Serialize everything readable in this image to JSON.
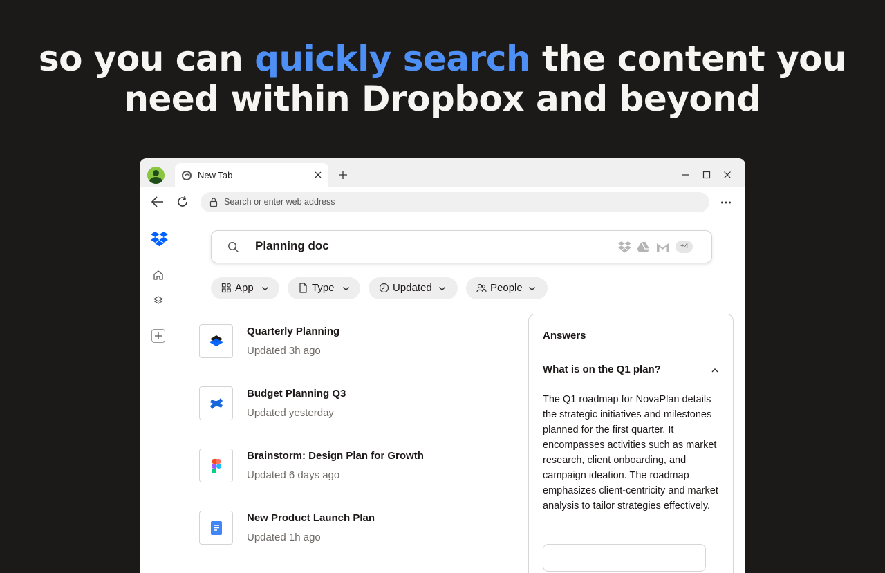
{
  "headline": {
    "before": "so you can ",
    "accent": "quickly search",
    "after": " the content you",
    "line2": "need within Dropbox and beyond"
  },
  "browser": {
    "tab_title": "New Tab",
    "address_placeholder": "Search or enter web address"
  },
  "search": {
    "query": "Planning doc",
    "sources": [
      "dropbox-icon",
      "google-drive-icon",
      "gmail-icon"
    ],
    "more_sources": "+4"
  },
  "filters": [
    {
      "label": "App",
      "icon": "apps-icon"
    },
    {
      "label": "Type",
      "icon": "file-icon"
    },
    {
      "label": "Updated",
      "icon": "clock-icon"
    },
    {
      "label": "People",
      "icon": "people-icon"
    }
  ],
  "results": [
    {
      "title": "Quarterly Planning",
      "subtitle": "Updated 3h ago",
      "app": "dropbox-paper-icon"
    },
    {
      "title": "Budget Planning Q3",
      "subtitle": "Updated yesterday",
      "app": "confluence-icon"
    },
    {
      "title": "Brainstorm: Design Plan for Growth",
      "subtitle": "Updated 6 days ago",
      "app": "figma-icon"
    },
    {
      "title": "New Product Launch Plan",
      "subtitle": "Updated 1h ago",
      "app": "google-docs-icon"
    }
  ],
  "answers": {
    "title": "Answers",
    "question": "What is on the Q1 plan?",
    "body": "The Q1 roadmap for NovaPlan details the strategic initiatives and milestones planned for the first quarter. It encompasses activities such as market research, client onboarding, and campaign ideation. The roadmap emphasizes client-centricity and market analysis to tailor strategies effectively."
  },
  "colors": {
    "background": "#1b1a19",
    "accent": "#4d8ff5",
    "dropbox_blue": "#0061fe"
  }
}
